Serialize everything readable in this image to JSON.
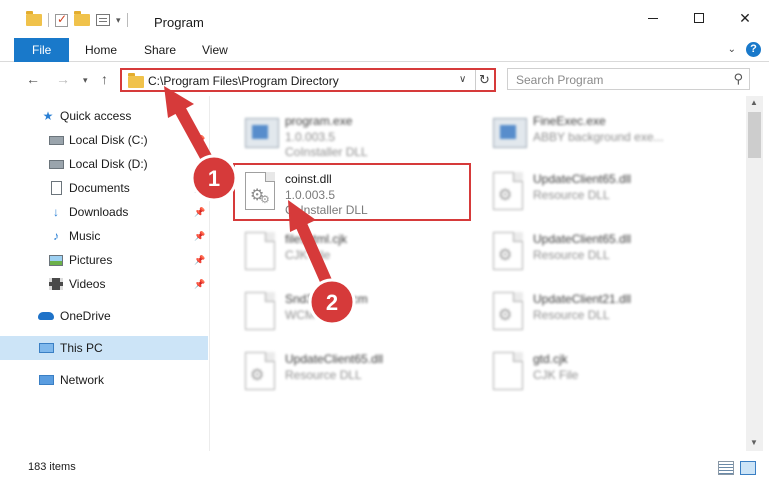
{
  "window": {
    "title": "Program",
    "controls": {
      "minimize": "—",
      "maximize": "☐",
      "close": "✕"
    }
  },
  "ribbon": {
    "tabs": [
      {
        "label": "File"
      },
      {
        "label": "Home"
      },
      {
        "label": "Share"
      },
      {
        "label": "View"
      }
    ],
    "help": "?"
  },
  "nav": {
    "back": "←",
    "forward": "→",
    "recent": "▾",
    "up": "↑",
    "address": "C:\\Program Files\\Program Directory",
    "refresh": "↻",
    "search_placeholder": "Search Program"
  },
  "sidebar": {
    "items": [
      {
        "label": "Quick access",
        "icon": "star-icon",
        "pinned": false
      },
      {
        "label": "Local Disk (C:)",
        "icon": "disk-icon",
        "pinned": true
      },
      {
        "label": "Local Disk (D:)",
        "icon": "disk-icon",
        "pinned": true
      },
      {
        "label": "Documents",
        "icon": "document-icon",
        "pinned": true
      },
      {
        "label": "Downloads",
        "icon": "download-icon",
        "pinned": true
      },
      {
        "label": "Music",
        "icon": "music-icon",
        "pinned": true
      },
      {
        "label": "Pictures",
        "icon": "pictures-icon",
        "pinned": true
      },
      {
        "label": "Videos",
        "icon": "videos-icon",
        "pinned": true
      },
      {
        "label": "OneDrive",
        "icon": "cloud-icon",
        "pinned": false
      },
      {
        "label": "This PC",
        "icon": "computer-icon",
        "pinned": false,
        "selected": true
      },
      {
        "label": "Network",
        "icon": "network-icon",
        "pinned": false
      }
    ]
  },
  "files": [
    {
      "name": "program.exe",
      "line1": "1.0.003.5",
      "line2": "CoInstaller DLL",
      "icon": "exe-icon",
      "blurred": true
    },
    {
      "name": "FineExec.exe",
      "line1": "ABBY background exe...",
      "line2": "",
      "icon": "exe-icon",
      "blurred": true
    },
    {
      "name": "coinst.dll",
      "line1": "1.0.003.5",
      "line2": "CoInstaller DLL",
      "icon": "dll-icon",
      "blurred": false
    },
    {
      "name": "UpdateClient65.dll",
      "line1": "Resource DLL",
      "line2": "",
      "icon": "dll-icon",
      "blurred": true
    },
    {
      "name": "fileshtml.cjk",
      "line1": "CJK File",
      "line2": "",
      "icon": "file-icon",
      "blurred": true
    },
    {
      "name": "UpdateClient65.dll",
      "line1": "Resource DLL",
      "line2": "",
      "icon": "dll-icon",
      "blurred": true
    },
    {
      "name": "Snd32004.wcm",
      "line1": "WCM File",
      "line2": "",
      "icon": "file-icon",
      "blurred": true
    },
    {
      "name": "UpdateClient21.dll",
      "line1": "Resource DLL",
      "line2": "",
      "icon": "dll-icon",
      "blurred": true
    },
    {
      "name": "UpdateClient65.dll",
      "line1": "Resource DLL",
      "line2": "",
      "icon": "dll-icon",
      "blurred": true
    },
    {
      "name": "gtd.cjk",
      "line1": "CJK File",
      "line2": "",
      "icon": "file-icon",
      "blurred": true
    }
  ],
  "callouts": [
    {
      "number": "1",
      "color": "#d63a3a"
    },
    {
      "number": "2",
      "color": "#d63a3a"
    }
  ],
  "status": {
    "item_count": "183 items"
  },
  "colors": {
    "accent": "#1979ca",
    "highlight": "#d63a3a",
    "selected": "#cce4f7"
  }
}
